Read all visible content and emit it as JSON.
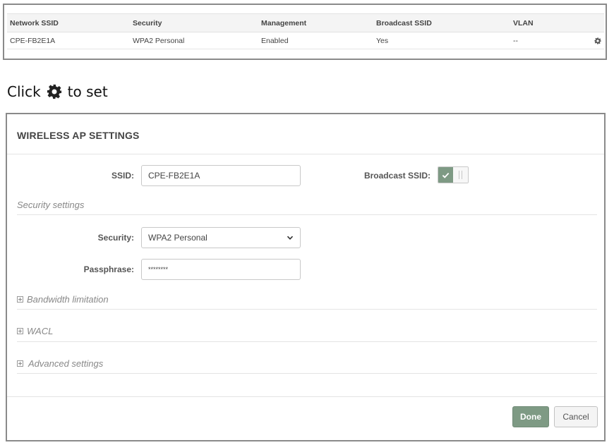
{
  "ssid_table": {
    "headers": [
      "Network SSID",
      "Security",
      "Management",
      "Broadcast SSID",
      "VLAN"
    ],
    "rows": [
      {
        "cells": [
          "CPE-FB2E1A",
          "WPA2 Personal",
          "Enabled",
          "Yes",
          "--"
        ],
        "action_icon": "gear-icon"
      }
    ]
  },
  "caption": {
    "before": "Click",
    "icon": "gear-icon",
    "after": "to set"
  },
  "panel": {
    "title": "WIRELESS AP SETTINGS",
    "ssid_label": "SSID:",
    "ssid_value": "CPE-FB2E1A",
    "broadcast_label": "Broadcast SSID:",
    "broadcast_enabled": true,
    "security_section": "Security settings",
    "security_label": "Security:",
    "security_value": "WPA2 Personal",
    "passphrase_label": "Passphrase:",
    "passphrase_value": "********",
    "sections": [
      "Bandwidth limitation",
      "WACL",
      "Advanced settings"
    ],
    "done_label": "Done",
    "cancel_label": "Cancel"
  },
  "colors": {
    "accent": "#7e9a84",
    "border": "#8a8a8a"
  }
}
